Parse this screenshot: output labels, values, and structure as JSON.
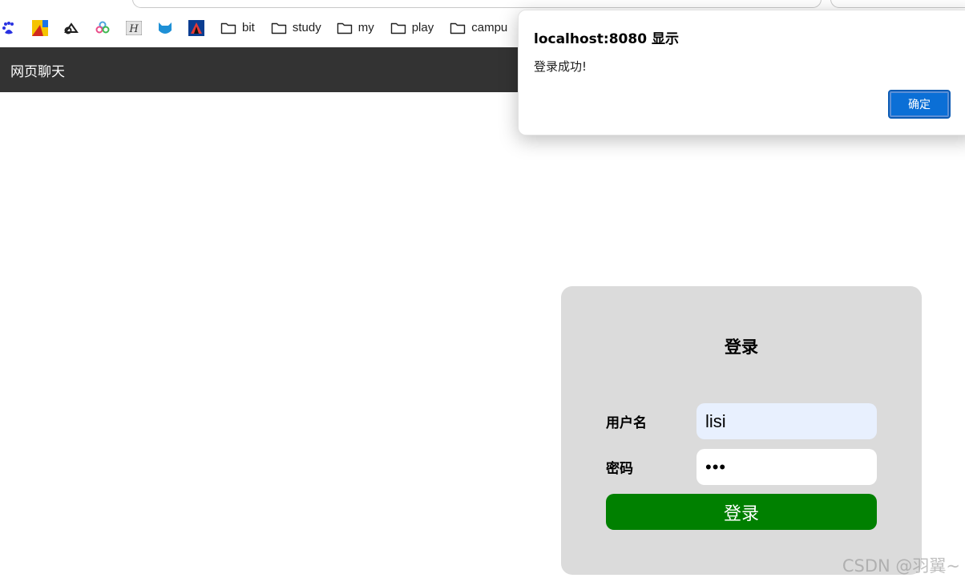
{
  "bookmarks": [
    {
      "type": "folder",
      "label": "bit"
    },
    {
      "type": "folder",
      "label": "study"
    },
    {
      "type": "folder",
      "label": "my"
    },
    {
      "type": "folder",
      "label": "play"
    },
    {
      "type": "folder",
      "label": "campu"
    }
  ],
  "bookmark_icons": [
    "baidu-paw-icon",
    "yellow-app-icon",
    "cloud-outline-icon",
    "colorful-app-icon",
    "h-logo-icon",
    "blue-cat-icon",
    "red-blue-app-icon"
  ],
  "nav": {
    "title": "网页聊天"
  },
  "login": {
    "title": "登录",
    "username_label": "用户名",
    "username_value": "lisi",
    "password_label": "密码",
    "password_value": "•••",
    "submit_label": "登录"
  },
  "dialog": {
    "title": "localhost:8080 显示",
    "message": "登录成功!",
    "ok_label": "确定"
  },
  "watermark": "CSDN @羽翼~",
  "colors": {
    "nav_bg": "#333333",
    "card_bg": "#dbdbdb",
    "submit_bg": "#008000",
    "dialog_ok_bg": "#0b6fd6",
    "autofill_bg": "#e8f0fe"
  }
}
